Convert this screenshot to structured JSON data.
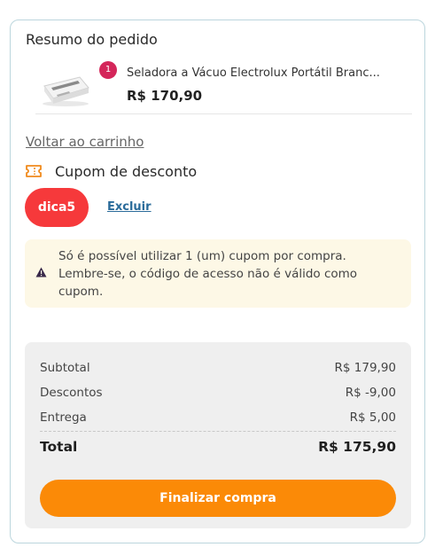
{
  "order_summary": {
    "title": "Resumo do pedido"
  },
  "product": {
    "quantity": "1",
    "name": "Seladora a Vácuo Electrolux Portátil Branc...",
    "price": "R$ 170,90",
    "image_icon": "vacuum-sealer-thumbnail"
  },
  "back_link": "Voltar ao carrinho",
  "coupon": {
    "heading": "Cupom de desconto",
    "code": "dica5",
    "remove_label": "Excluir",
    "notice": "Só é possível utilizar 1 (um) cupom por compra. Lembre-se, o código de acesso não é válido como cupom."
  },
  "totals": {
    "subtotal_label": "Subtotal",
    "subtotal_value": "R$ 179,90",
    "discounts_label": "Descontos",
    "discounts_value": "R$ -9,00",
    "delivery_label": "Entrega",
    "delivery_value": "R$ 5,00",
    "total_label": "Total",
    "total_value": "R$ 175,90"
  },
  "checkout_button": "Finalizar compra",
  "colors": {
    "accent_orange": "#fb8a07",
    "coupon_red": "#f6393b",
    "badge_pink": "#d4265a",
    "link_blue": "#2a6b9a",
    "notice_bg": "#fdf8e6"
  }
}
